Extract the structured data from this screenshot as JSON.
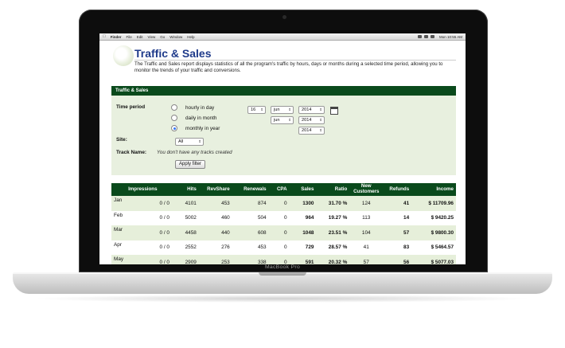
{
  "device": {
    "brand": "MacBook Pro"
  },
  "menubar": {
    "app": "Finder",
    "items": [
      "File",
      "Edit",
      "View",
      "Go",
      "Window",
      "Help"
    ],
    "clock": "Mon 10:55 AM"
  },
  "page": {
    "title": "Traffic & Sales",
    "description": "The Traffic and Sales report displays statistics of all the program's traffic by hours, days or months during a selected time period, allowing you to monitor the trends of your traffic and conversions."
  },
  "filter": {
    "header": "Traffic & Sales",
    "time_period_label": "Time period",
    "options": [
      {
        "label": "hourly in day",
        "selected": false
      },
      {
        "label": "daily in month",
        "selected": false
      },
      {
        "label": "monthly in year",
        "selected": true
      }
    ],
    "hourly_day": "16",
    "hourly_month": "jun",
    "hourly_year": "2014",
    "daily_month": "jun",
    "daily_year": "2014",
    "monthly_year": "2014",
    "site_label": "Site:",
    "site_value": "All",
    "track_label": "Track Name:",
    "track_note": "You don't have any tracks created",
    "apply_label": "Apply filter"
  },
  "table": {
    "columns": [
      "",
      "Impressions",
      "Hits",
      "RevShare",
      "Renewals",
      "CPA",
      "Sales",
      "Ratio",
      "New Customers",
      "Refunds",
      "Income"
    ],
    "rows": [
      {
        "month": "Jan",
        "impressions": "0 / 0",
        "hits": "4101",
        "revshare": "453",
        "renewals": "874",
        "cpa": "0",
        "sales": "1300",
        "ratio": "31.70 %",
        "new_customers": "124",
        "refunds": "41",
        "income": "$ 11709.96"
      },
      {
        "month": "Feb",
        "impressions": "0 / 0",
        "hits": "5002",
        "revshare": "460",
        "renewals": "504",
        "cpa": "0",
        "sales": "964",
        "ratio": "19.27 %",
        "new_customers": "113",
        "refunds": "14",
        "income": "$ 9420.25"
      },
      {
        "month": "Mar",
        "impressions": "0 / 0",
        "hits": "4458",
        "revshare": "440",
        "renewals": "608",
        "cpa": "0",
        "sales": "1048",
        "ratio": "23.51 %",
        "new_customers": "104",
        "refunds": "57",
        "income": "$ 9800.30"
      },
      {
        "month": "Apr",
        "impressions": "0 / 0",
        "hits": "2552",
        "revshare": "276",
        "renewals": "453",
        "cpa": "0",
        "sales": "729",
        "ratio": "28.57 %",
        "new_customers": "41",
        "refunds": "83",
        "income": "$ 5464.57"
      },
      {
        "month": "May",
        "impressions": "0 / 0",
        "hits": "2909",
        "revshare": "253",
        "renewals": "338",
        "cpa": "0",
        "sales": "591",
        "ratio": "20.32 %",
        "new_customers": "57",
        "refunds": "56",
        "income": "$ 5077.03"
      }
    ]
  },
  "colors": {
    "header_green": "#0a4a1c",
    "panel_green": "#e8f0df",
    "title_blue": "#1e3a8a"
  }
}
